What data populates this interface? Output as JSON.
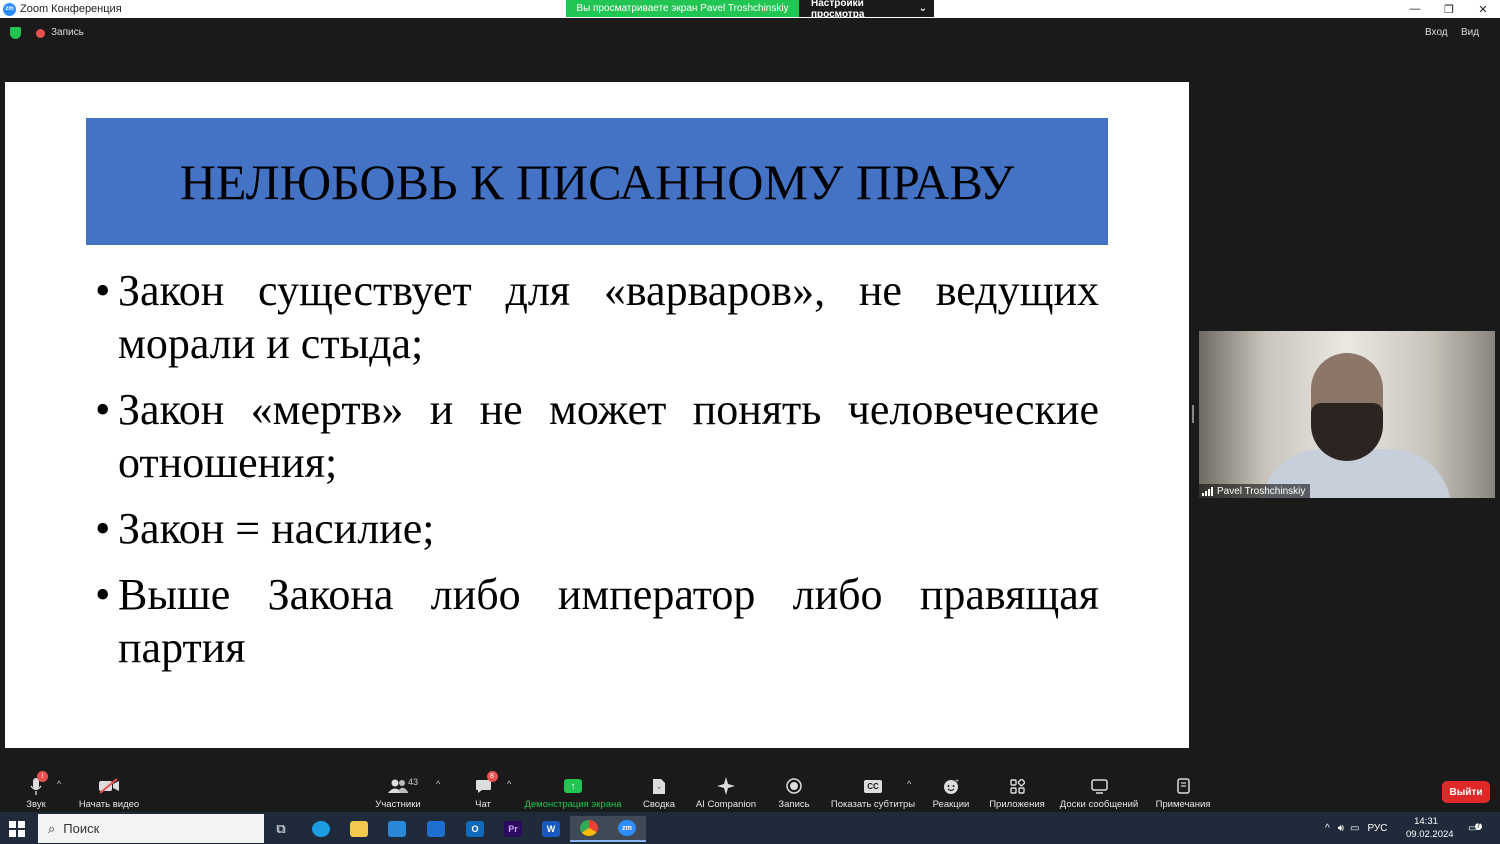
{
  "window": {
    "title": "Zoom Конференция",
    "app_icon_text": "zm",
    "controls": [
      "—",
      "❐",
      "✕"
    ]
  },
  "share_banner": {
    "text": "Вы просматриваете экран Pavel Troshchinskiy",
    "view_options": "Настройки просмотра",
    "view_options_caret": "⌄"
  },
  "topbar": {
    "recording_label": "Запись",
    "login_label": "Вход",
    "view_label": "Вид"
  },
  "slide": {
    "title": "НЕЛЮБОВЬ К ПИСАННОМУ ПРАВУ",
    "bullets": [
      "Закон существует для «варваров», не ведущих морали и стыда;",
      "Закон «мертв» и не может понять человеческие отношения;",
      "Закон = насилие;",
      "Выше Закона либо император либо правящая партия"
    ]
  },
  "video": {
    "participant_name": "Pavel Troshchinskiy"
  },
  "toolbar": {
    "audio": {
      "label": "Звук",
      "icon": "microphone-icon"
    },
    "video": {
      "label": "Начать видео",
      "icon": "video-off-icon"
    },
    "participants": {
      "label": "Участники",
      "count": "43"
    },
    "chat": {
      "label": "Чат",
      "badge": "8"
    },
    "share": {
      "label": "Демонстрация экрана"
    },
    "summary": {
      "label": "Сводка"
    },
    "ai": {
      "label": "AI Companion"
    },
    "record": {
      "label": "Запись"
    },
    "captions": {
      "label": "Показать субтитры",
      "icon_text": "CC"
    },
    "reactions": {
      "label": "Реакции"
    },
    "apps": {
      "label": "Приложения"
    },
    "whiteboards": {
      "label": "Доски сообщений"
    },
    "notes": {
      "label": "Примечания"
    },
    "exit_label": "Выйти",
    "caret": "^"
  },
  "taskbar": {
    "search_placeholder": "Поиск",
    "language": "РУС",
    "time": "14:31",
    "date": "09.02.2024",
    "notification_count": "7",
    "icons": [
      "task-view-icon",
      "edge-icon",
      "file-explorer-icon",
      "store-icon",
      "mail-icon",
      "outlook-icon",
      "premiere-icon",
      "word-icon",
      "chrome-icon",
      "zoom-icon"
    ],
    "word_letter": "W",
    "premiere_letters": "Pr",
    "outlook_letter": "O",
    "zoom_letters": "zm"
  },
  "colors": {
    "slide_title_bg": "#4472c4",
    "share_green": "#23c552",
    "exit_red": "#e02828",
    "taskbar_bg": "#1f2b3a"
  }
}
